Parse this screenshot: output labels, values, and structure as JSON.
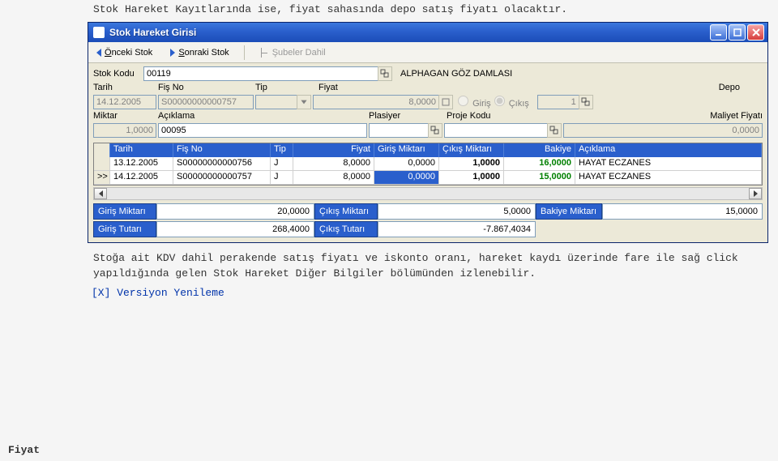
{
  "doc": {
    "top_text": "Stok Hareket Kayıtlarında ise, fiyat sahasında depo satış fiyatı olacaktır.",
    "mid_text": "Stoğa ait KDV dahil perakende satış fiyatı ve iskonto oranı, hareket kaydı üzerinde fare ile sağ click yapıldığında gelen Stok Hareket Diğer Bilgiler bölümünden izlenebilir.",
    "side_label": "Fiyat",
    "bottom_text": "[X] Versiyon Yenileme"
  },
  "window": {
    "title": "Stok Hareket Girisi"
  },
  "toolbar": {
    "prev": "Önceki Stok",
    "next": "Sonraki Stok",
    "branches": "Şubeler Dahil"
  },
  "form": {
    "stok_kodu_label": "Stok Kodu",
    "stok_kodu": "00119",
    "stok_adi": "ALPHAGAN GÖZ DAMLASI",
    "tarih_label": "Tarih",
    "tarih": "14.12.2005",
    "fisno_label": "Fiş No",
    "fisno": "S00000000000757",
    "tip_label": "Tip",
    "tip": "",
    "fiyat_label": "Fiyat",
    "fiyat": "8,0000",
    "giris_label": "Giriş",
    "cikis_label": "Çıkış",
    "depo_label": "Depo",
    "depo": "1",
    "miktar_label": "Miktar",
    "miktar": "1,0000",
    "aciklama_label": "Açıklama",
    "aciklama": "00095",
    "plasiyer_label": "Plasiyer",
    "plasiyer": "",
    "proje_label": "Proje Kodu",
    "proje": "",
    "maliyet_label": "Maliyet Fiyatı",
    "maliyet": "0,0000"
  },
  "grid": {
    "headers": {
      "tarih": "Tarih",
      "fisno": "Fiş No",
      "tip": "Tip",
      "fiyat": "Fiyat",
      "giris": "Giriş Miktarı",
      "cikis": "Çıkış Miktarı",
      "bakiye": "Bakiye",
      "aciklama": "Açıklama"
    },
    "rows": [
      {
        "mark": "",
        "tarih": "13.12.2005",
        "fisno": "S00000000000756",
        "tip": "J",
        "fiyat": "8,0000",
        "giris": "0,0000",
        "cikis": "1,0000",
        "bakiye": "16,0000",
        "aciklama": "HAYAT ECZANES"
      },
      {
        "mark": ">>",
        "tarih": "14.12.2005",
        "fisno": "S00000000000757",
        "tip": "J",
        "fiyat": "8,0000",
        "giris": "0,0000",
        "cikis": "1,0000",
        "bakiye": "15,0000",
        "aciklama": "HAYAT ECZANES"
      }
    ]
  },
  "summary": {
    "giris_miktar_label": "Giriş Miktarı",
    "giris_miktar": "20,0000",
    "cikis_miktar_label": "Çıkış Miktarı",
    "cikis_miktar": "5,0000",
    "bakiye_miktar_label": "Bakiye Miktarı",
    "bakiye_miktar": "15,0000",
    "giris_tutar_label": "Giriş Tutarı",
    "giris_tutar": "268,4000",
    "cikis_tutar_label": "Çıkış Tutarı",
    "cikis_tutar": "-7.867,4034"
  }
}
